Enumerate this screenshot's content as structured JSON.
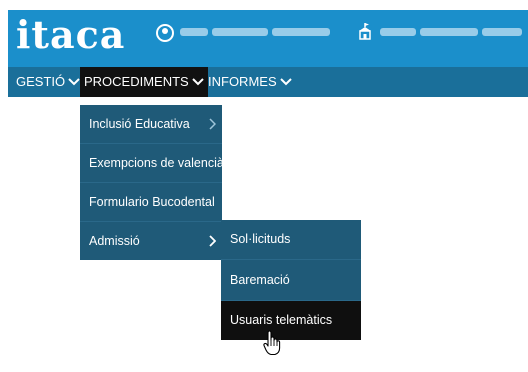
{
  "header": {
    "logo": "itaca"
  },
  "nav": {
    "items": [
      {
        "label": "GESTIÓ"
      },
      {
        "label": "PROCEDIMENTS"
      },
      {
        "label": "INFORMES"
      }
    ]
  },
  "procediments_menu": {
    "items": [
      {
        "label": "Inclusió Educativa"
      },
      {
        "label": "Exempcions de valencià"
      },
      {
        "label": "Formulario Bucodental"
      },
      {
        "label": "Admissió"
      }
    ]
  },
  "admissio_submenu": {
    "items": [
      {
        "label": "Sol·licituds"
      },
      {
        "label": "Baremació"
      },
      {
        "label": "Usuaris telemàtics"
      }
    ]
  },
  "colors": {
    "header_bg": "#1b8fcb",
    "navbar_bg": "#1a6f9a",
    "menu_bg": "#1f5a78",
    "active_bg": "#0f0f0f"
  },
  "icons": [
    "user-icon",
    "school-icon",
    "chevron-down-icon",
    "chevron-right-icon",
    "hand-cursor-icon"
  ]
}
